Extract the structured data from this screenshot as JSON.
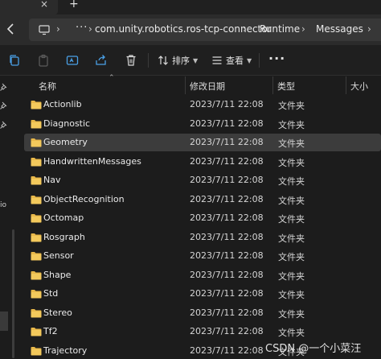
{
  "tabstrip": {
    "close_glyph": "×",
    "new_tab_glyph": "+"
  },
  "address": {
    "more_label": "···",
    "separator": "›",
    "crumbs": [
      "com.unity.robotics.ros-tcp-connector",
      "Runtime",
      "Messages"
    ]
  },
  "toolbar": {
    "sort_label": "排序",
    "view_label": "查看",
    "more_label": "···"
  },
  "columns": {
    "name": "名称",
    "modified": "修改日期",
    "type": "类型",
    "size": "大小"
  },
  "files": [
    {
      "name": "Actionlib",
      "modified": "2023/7/11 22:08",
      "type": "文件夹",
      "selected": false
    },
    {
      "name": "Diagnostic",
      "modified": "2023/7/11 22:08",
      "type": "文件夹",
      "selected": false
    },
    {
      "name": "Geometry",
      "modified": "2023/7/11 22:08",
      "type": "文件夹",
      "selected": true
    },
    {
      "name": "HandwrittenMessages",
      "modified": "2023/7/11 22:08",
      "type": "文件夹",
      "selected": false
    },
    {
      "name": "Nav",
      "modified": "2023/7/11 22:08",
      "type": "文件夹",
      "selected": false
    },
    {
      "name": "ObjectRecognition",
      "modified": "2023/7/11 22:08",
      "type": "文件夹",
      "selected": false
    },
    {
      "name": "Octomap",
      "modified": "2023/7/11 22:08",
      "type": "文件夹",
      "selected": false
    },
    {
      "name": "Rosgraph",
      "modified": "2023/7/11 22:08",
      "type": "文件夹",
      "selected": false
    },
    {
      "name": "Sensor",
      "modified": "2023/7/11 22:08",
      "type": "文件夹",
      "selected": false
    },
    {
      "name": "Shape",
      "modified": "2023/7/11 22:08",
      "type": "文件夹",
      "selected": false
    },
    {
      "name": "Std",
      "modified": "2023/7/11 22:08",
      "type": "文件夹",
      "selected": false
    },
    {
      "name": "Stereo",
      "modified": "2023/7/11 22:08",
      "type": "文件夹",
      "selected": false
    },
    {
      "name": "Tf2",
      "modified": "2023/7/11 22:08",
      "type": "文件夹",
      "selected": false
    },
    {
      "name": "Trajectory",
      "modified": "2023/7/11 22:08",
      "type": "文件夹",
      "selected": false
    }
  ],
  "nav_fragment": "io",
  "watermark": "CSDN @一个小菜汪",
  "colors": {
    "background": "#1c1c1c",
    "folder": "#e8b84a",
    "selected_row": "#3c3c3c"
  },
  "icons": [
    "close-icon",
    "add-tab-icon",
    "back-arrow-icon",
    "computer-icon",
    "copy-icon",
    "paste-icon",
    "rename-icon",
    "share-icon",
    "delete-icon",
    "sort-icon",
    "view-icon",
    "pin-icon",
    "folder-icon"
  ]
}
